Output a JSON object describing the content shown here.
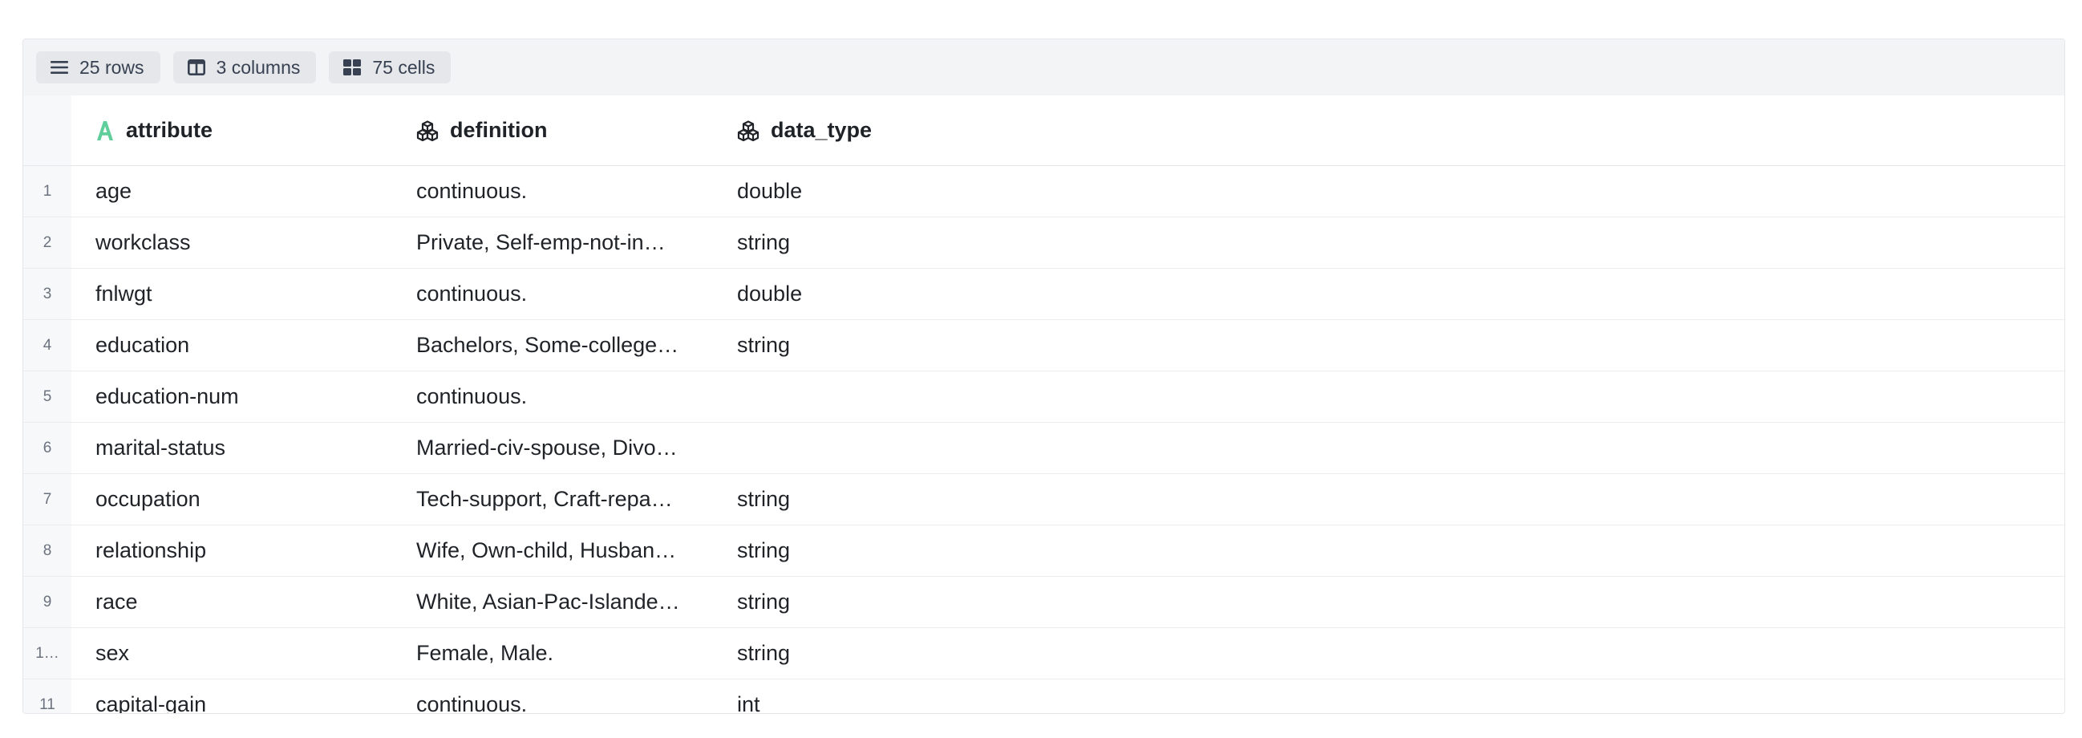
{
  "toolbar": {
    "rows_label": "25 rows",
    "columns_label": "3 columns",
    "cells_label": "75 cells"
  },
  "columns": [
    {
      "name": "attribute",
      "icon": "text-type-icon"
    },
    {
      "name": "definition",
      "icon": "cubes-icon"
    },
    {
      "name": "data_type",
      "icon": "cubes-icon"
    }
  ],
  "rows": [
    {
      "index": "1",
      "attribute": "age",
      "definition": "continuous.",
      "data_type": "double"
    },
    {
      "index": "2",
      "attribute": "workclass",
      "definition": "Private, Self-emp-not-in…",
      "data_type": "string"
    },
    {
      "index": "3",
      "attribute": "fnlwgt",
      "definition": "continuous.",
      "data_type": "double"
    },
    {
      "index": "4",
      "attribute": "education",
      "definition": "Bachelors, Some-college…",
      "data_type": "string"
    },
    {
      "index": "5",
      "attribute": "education-num",
      "definition": "continuous.",
      "data_type": ""
    },
    {
      "index": "6",
      "attribute": "marital-status",
      "definition": "Married-civ-spouse, Divo…",
      "data_type": ""
    },
    {
      "index": "7",
      "attribute": "occupation",
      "definition": "Tech-support, Craft-repa…",
      "data_type": "string"
    },
    {
      "index": "8",
      "attribute": "relationship",
      "definition": "Wife, Own-child, Husban…",
      "data_type": "string"
    },
    {
      "index": "9",
      "attribute": "race",
      "definition": "White, Asian-Pac-Islande…",
      "data_type": "string"
    },
    {
      "index": "1…",
      "attribute": "sex",
      "definition": "Female, Male.",
      "data_type": "string"
    },
    {
      "index": "11",
      "attribute": "capital-gain",
      "definition": "continuous.",
      "data_type": "int"
    }
  ],
  "colors": {
    "toolbar_bg": "#f3f4f6",
    "chip_bg": "#e5e7eb",
    "text_type_icon": "#5fce9b"
  }
}
